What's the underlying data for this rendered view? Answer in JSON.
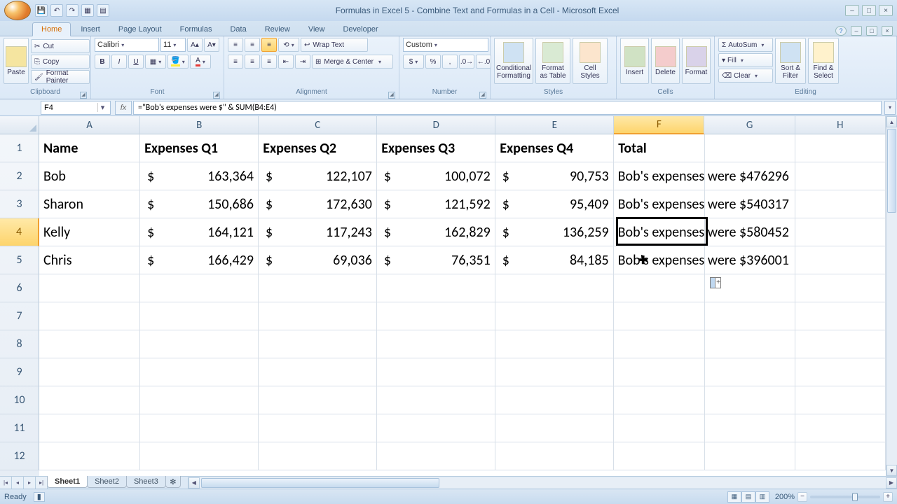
{
  "title": "Formulas in Excel 5 - Combine Text and Formulas in a Cell - Microsoft Excel",
  "tabs": [
    "Home",
    "Insert",
    "Page Layout",
    "Formulas",
    "Data",
    "Review",
    "View",
    "Developer"
  ],
  "active_tab": 0,
  "ribbon": {
    "clipboard": {
      "paste": "Paste",
      "cut": "Cut",
      "copy": "Copy",
      "fmt": "Format Painter",
      "label": "Clipboard"
    },
    "font": {
      "name": "Calibri",
      "size": "11",
      "label": "Font"
    },
    "alignment": {
      "wrap": "Wrap Text",
      "merge": "Merge & Center",
      "label": "Alignment"
    },
    "number": {
      "format": "Custom",
      "label": "Number"
    },
    "styles": {
      "cond": "Conditional Formatting",
      "table": "Format as Table",
      "cell": "Cell Styles",
      "label": "Styles"
    },
    "cells": {
      "insert": "Insert",
      "delete": "Delete",
      "format": "Format",
      "label": "Cells"
    },
    "editing": {
      "sum": "AutoSum",
      "fill": "Fill",
      "clear": "Clear",
      "sort": "Sort & Filter",
      "find": "Find & Select",
      "label": "Editing"
    }
  },
  "namebox": "F4",
  "formula": "=\"Bob's expenses were $\" & SUM(B4:E4)",
  "columns": [
    {
      "id": "A",
      "w": 145
    },
    {
      "id": "B",
      "w": 170
    },
    {
      "id": "C",
      "w": 170
    },
    {
      "id": "D",
      "w": 170
    },
    {
      "id": "E",
      "w": 170
    },
    {
      "id": "F",
      "w": 130
    },
    {
      "id": "G",
      "w": 130
    },
    {
      "id": "H",
      "w": 130
    }
  ],
  "selected_cell": {
    "col": "F",
    "row": 4
  },
  "headers": [
    "Name",
    "Expenses Q1",
    "Expenses Q2",
    "Expenses Q3",
    "Expenses Q4",
    "Total"
  ],
  "rows": [
    {
      "name": "Bob",
      "q": [
        "163,364",
        "122,107",
        "100,072",
        "90,753"
      ],
      "total": "Bob's expenses were $476296"
    },
    {
      "name": "Sharon",
      "q": [
        "150,686",
        "172,630",
        "121,592",
        "95,409"
      ],
      "total": "Bob's expenses were $540317"
    },
    {
      "name": "Kelly",
      "q": [
        "164,121",
        "117,243",
        "162,829",
        "136,259"
      ],
      "total": "Bob's expenses were $580452"
    },
    {
      "name": "Chris",
      "q": [
        "166,429",
        "69,036",
        "76,351",
        "84,185"
      ],
      "total": "Bob's expenses were $396001"
    }
  ],
  "visible_rows": 12,
  "sheets": [
    "Sheet1",
    "Sheet2",
    "Sheet3"
  ],
  "active_sheet": 0,
  "status": "Ready",
  "zoom": "200%"
}
